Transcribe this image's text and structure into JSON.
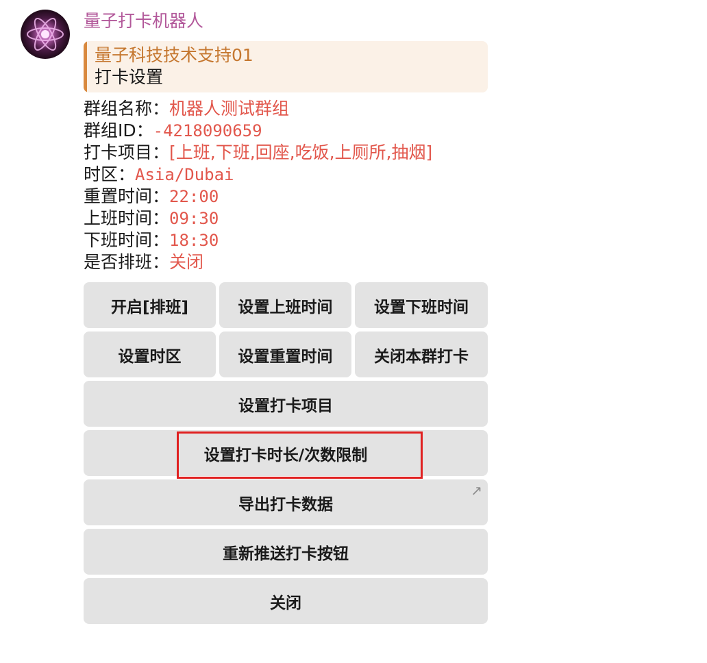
{
  "message": {
    "sender": "量子打卡机器人",
    "reply": {
      "author": "量子科技技术支持01",
      "text": "打卡设置"
    },
    "info_rows": [
      {
        "label": "群组名称：",
        "value": "机器人测试群组"
      },
      {
        "label": "群组ID：",
        "value": "-4218090659"
      },
      {
        "label": "打卡项目：",
        "value": "[上班,下班,回座,吃饭,上厕所,抽烟]"
      },
      {
        "label": "时区：",
        "value": "Asia/Dubai"
      },
      {
        "label": "重置时间：",
        "value": "22:00"
      },
      {
        "label": "上班时间：",
        "value": "09:30"
      },
      {
        "label": "下班时间：",
        "value": "18:30"
      },
      {
        "label": "是否排班：",
        "value": "关闭"
      }
    ]
  },
  "keyboard": {
    "enable_shift": "开启[排班]",
    "set_work_start": "设置上班时间",
    "set_work_end": "设置下班时间",
    "set_timezone": "设置时区",
    "set_reset_time": "设置重置时间",
    "close_group_checkin": "关闭本群打卡",
    "set_checkin_items": "设置打卡项目",
    "set_duration_limit": "设置打卡时长/次数限制",
    "export_data": "导出打卡数据",
    "resend_buttons": "重新推送打卡按钮",
    "close": "关闭",
    "link_arrow": "↗"
  },
  "colors": {
    "sender": "#b2589a",
    "reply_accent": "#d9893e",
    "reply_background": "#fbf1e7",
    "value_text": "#e2574c",
    "button_background": "#e3e3e3",
    "highlight": "#e02020"
  }
}
